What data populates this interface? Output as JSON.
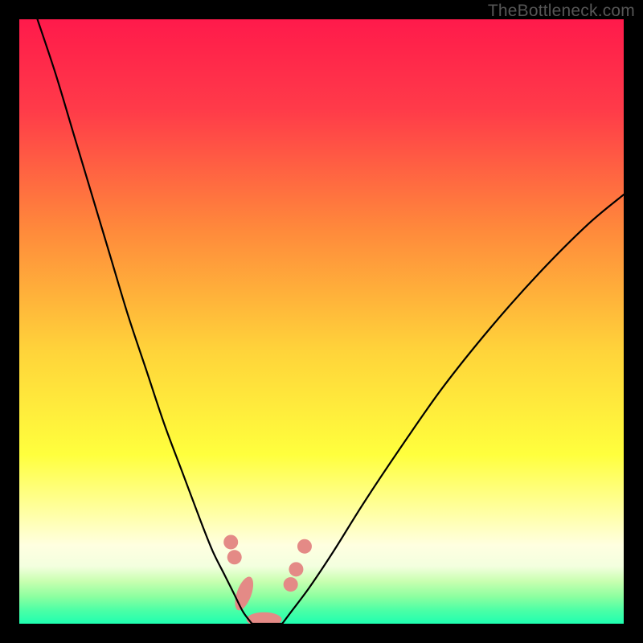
{
  "watermark": "TheBottleneck.com",
  "chart_data": {
    "type": "line",
    "title": "",
    "xlabel": "",
    "ylabel": "",
    "xlim": [
      0,
      100
    ],
    "ylim": [
      0,
      100
    ],
    "gradient_stops": [
      {
        "offset": 0.0,
        "color": "#ff1a4b"
      },
      {
        "offset": 0.15,
        "color": "#ff3b49"
      },
      {
        "offset": 0.35,
        "color": "#ff8a3b"
      },
      {
        "offset": 0.55,
        "color": "#ffd43a"
      },
      {
        "offset": 0.72,
        "color": "#ffff3d"
      },
      {
        "offset": 0.82,
        "color": "#ffffa8"
      },
      {
        "offset": 0.87,
        "color": "#ffffe0"
      },
      {
        "offset": 0.905,
        "color": "#f3ffdf"
      },
      {
        "offset": 0.93,
        "color": "#c8ffb0"
      },
      {
        "offset": 0.955,
        "color": "#8dffa0"
      },
      {
        "offset": 0.978,
        "color": "#4bffa6"
      },
      {
        "offset": 1.0,
        "color": "#1fffb0"
      }
    ],
    "series": [
      {
        "name": "left-curve",
        "x": [
          3,
          6,
          9,
          12,
          15,
          18,
          21,
          24,
          27,
          30,
          32,
          34,
          35.5,
          37,
          38.5
        ],
        "y": [
          100,
          91,
          81,
          71,
          61,
          51,
          42,
          33,
          25,
          17,
          12,
          8,
          5,
          2,
          0
        ]
      },
      {
        "name": "right-curve",
        "x": [
          43.5,
          45,
          48,
          52,
          57,
          63,
          70,
          78,
          86,
          94,
          100
        ],
        "y": [
          0,
          2,
          6,
          12,
          20,
          29,
          39,
          49,
          58,
          66,
          71
        ]
      },
      {
        "name": "valley-floor",
        "x": [
          38.5,
          40,
          41.5,
          43.5
        ],
        "y": [
          0,
          0,
          0,
          0
        ]
      }
    ],
    "markers": [
      {
        "name": "left-dot-1",
        "x": 35.0,
        "y": 13.5
      },
      {
        "name": "left-dot-2",
        "x": 35.6,
        "y": 11.0
      },
      {
        "name": "left-oval-1",
        "x": 37.2,
        "y": 5.0,
        "elongated": true,
        "angle": -70
      },
      {
        "name": "floor-oval",
        "x": 40.5,
        "y": 0.7,
        "elongated": true,
        "angle": 0
      },
      {
        "name": "right-dot-1",
        "x": 44.9,
        "y": 6.5
      },
      {
        "name": "right-dot-2",
        "x": 45.8,
        "y": 9.0
      },
      {
        "name": "right-dot-3",
        "x": 47.2,
        "y": 12.8
      }
    ],
    "marker_style": {
      "fill": "#e48a86",
      "r": 9,
      "oval_rx": 22,
      "oval_ry": 9
    },
    "curve_style": {
      "stroke": "#000000",
      "width": 2.2
    }
  }
}
